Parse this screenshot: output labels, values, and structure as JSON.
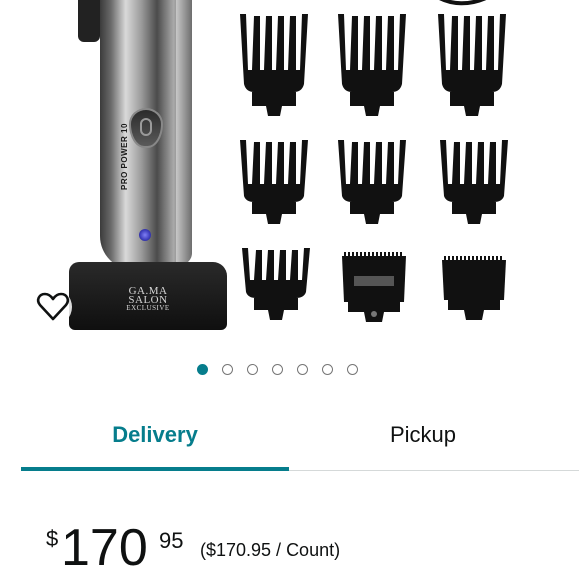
{
  "product_gallery": {
    "brand_logo_line1": "GA.MA",
    "brand_logo_line2": "SALON",
    "brand_logo_line3": "EXCLUSIVE",
    "model_text": "PRO POWER 10",
    "icons": {
      "favorite": "heart-outline-icon"
    },
    "pagination": {
      "total": 7,
      "active_index": 0
    },
    "accent_color": "#067d8c"
  },
  "fulfillment_tabs": {
    "delivery_label": "Delivery",
    "pickup_label": "Pickup",
    "selected": "Delivery"
  },
  "price": {
    "currency_symbol": "$",
    "whole": "170",
    "fraction": "95",
    "unit_price": "($170.95 / Count)"
  }
}
